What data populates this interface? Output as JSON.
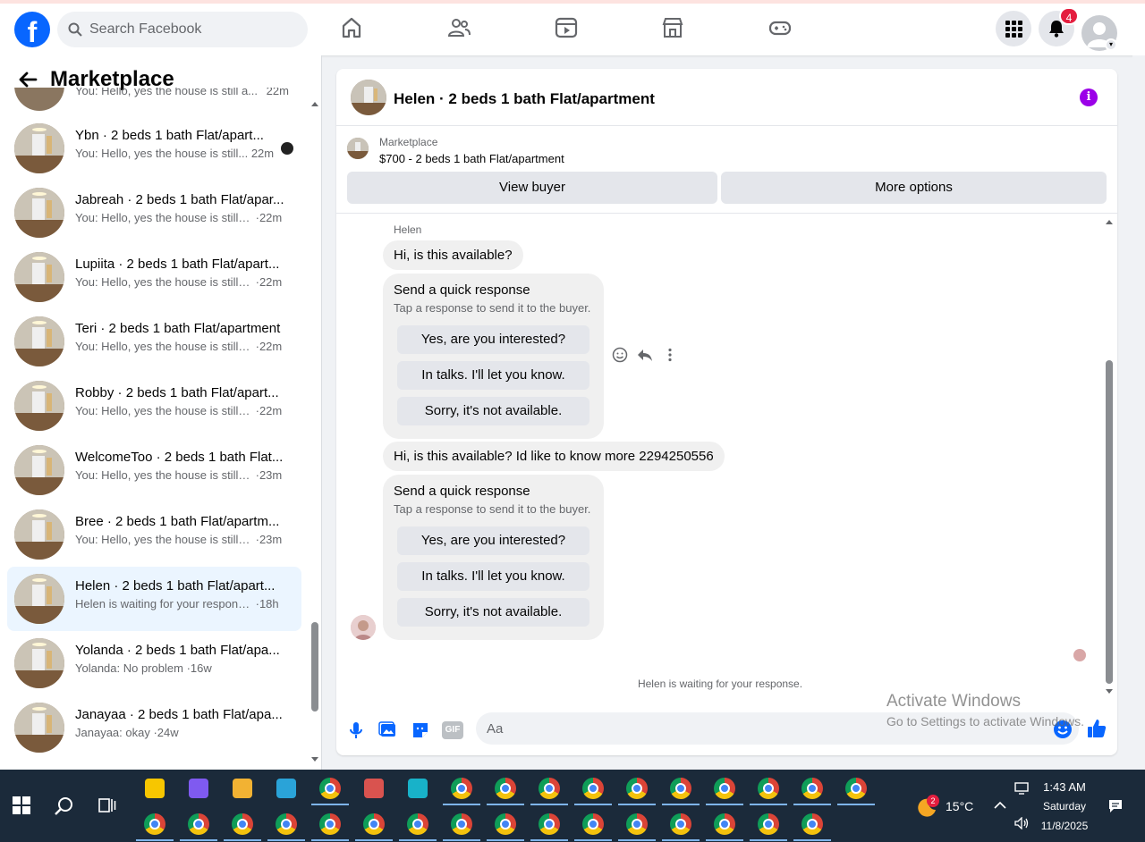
{
  "topnav": {
    "logo": "f",
    "search_placeholder": "Search Facebook",
    "icons": [
      "home-icon",
      "friends-icon",
      "video-icon",
      "marketplace-icon",
      "gaming-icon"
    ],
    "notifications_count": "4"
  },
  "sidebar": {
    "title": "Marketplace",
    "partial_row": {
      "subtitle": "You: Hello, yes the house is still a...",
      "time": "22m"
    },
    "conversations": [
      {
        "title": "Ybn · 2 beds 1 bath Flat/apart...",
        "snippet": "You: Hello, yes the house is still...",
        "time": "22m"
      },
      {
        "title": "Jabreah · 2 beds 1 bath Flat/apar...",
        "snippet": "You: Hello, yes the house is still a...",
        "time": "·22m"
      },
      {
        "title": "Lupiita · 2 beds 1 bath Flat/apart...",
        "snippet": "You: Hello, yes the house is still a...",
        "time": "·22m"
      },
      {
        "title": "Teri · 2 beds 1 bath Flat/apartment",
        "snippet": "You: Hello, yes the house is still a...",
        "time": "·22m"
      },
      {
        "title": "Robby · 2 beds 1 bath Flat/apart...",
        "snippet": "You: Hello, yes the house is still a...",
        "time": "·22m"
      },
      {
        "title": "WelcomeToo · 2 beds 1 bath Flat...",
        "snippet": "You: Hello, yes the house is still a...",
        "time": "·23m"
      },
      {
        "title": "Bree · 2 beds 1 bath Flat/apartm...",
        "snippet": "You: Hello, yes the house is still a...",
        "time": "·23m"
      },
      {
        "title": "Helen · 2 beds 1 bath Flat/apart...",
        "snippet": "Helen is waiting for your response.",
        "time": "·18h"
      },
      {
        "title": "Yolanda · 2 beds 1 bath Flat/apa...",
        "snippet": "Yolanda: No problem",
        "time": "·16w"
      },
      {
        "title": "Janayaa · 2 beds 1 bath Flat/apa...",
        "snippet": "Janayaa: okay",
        "time": "·24w"
      }
    ]
  },
  "chat": {
    "header_title": "Helen · 2 beds 1 bath Flat/apartment",
    "listing_label": "Marketplace",
    "listing_price": "$700 - 2 beds 1 bath Flat/apartment",
    "view_buyer": "View buyer",
    "more_options": "More options",
    "sender": "Helen",
    "message1": "Hi, is this available?",
    "message2": "Hi, is this available? Id like to know more 2294250556",
    "quick_title": "Send a quick response",
    "quick_sub": "Tap a response to send it to the buyer.",
    "quick_options": [
      "Yes, are you interested?",
      "In talks. I'll let you know.",
      "Sorry, it's not available."
    ],
    "waiting": "Helen is waiting for your response.",
    "composer_placeholder": "Aa",
    "gif_label": "GIF"
  },
  "watermark": {
    "line1": "Activate Windows",
    "line2": "Go to Settings to activate Windows."
  },
  "taskbar": {
    "weather_badge": "2",
    "temperature": "15°C",
    "time": "1:43 AM",
    "day": "Saturday",
    "date": "11/8/2025"
  },
  "colors": {
    "fb_blue": "#0866ff",
    "active_row": "#ebf5ff",
    "badge_red": "#e41e3f",
    "info_purple": "#9b00e8"
  }
}
